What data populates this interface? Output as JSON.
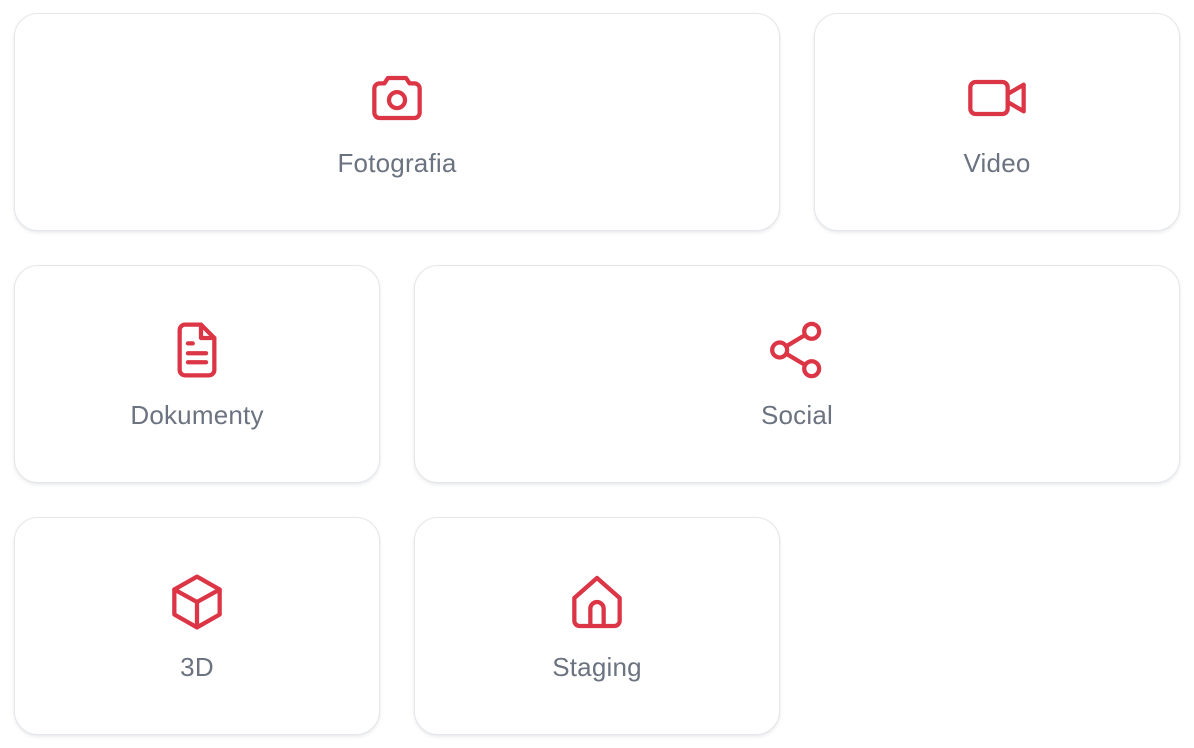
{
  "accent_color": "#dc3545",
  "cards": {
    "fotografia": {
      "label": "Fotografia",
      "icon": "camera-icon"
    },
    "video": {
      "label": "Video",
      "icon": "video-camera-icon"
    },
    "dokumenty": {
      "label": "Dokumenty",
      "icon": "document-icon"
    },
    "social": {
      "label": "Social",
      "icon": "share-icon"
    },
    "3d": {
      "label": "3D",
      "icon": "cube-icon"
    },
    "staging": {
      "label": "Staging",
      "icon": "home-icon"
    }
  }
}
